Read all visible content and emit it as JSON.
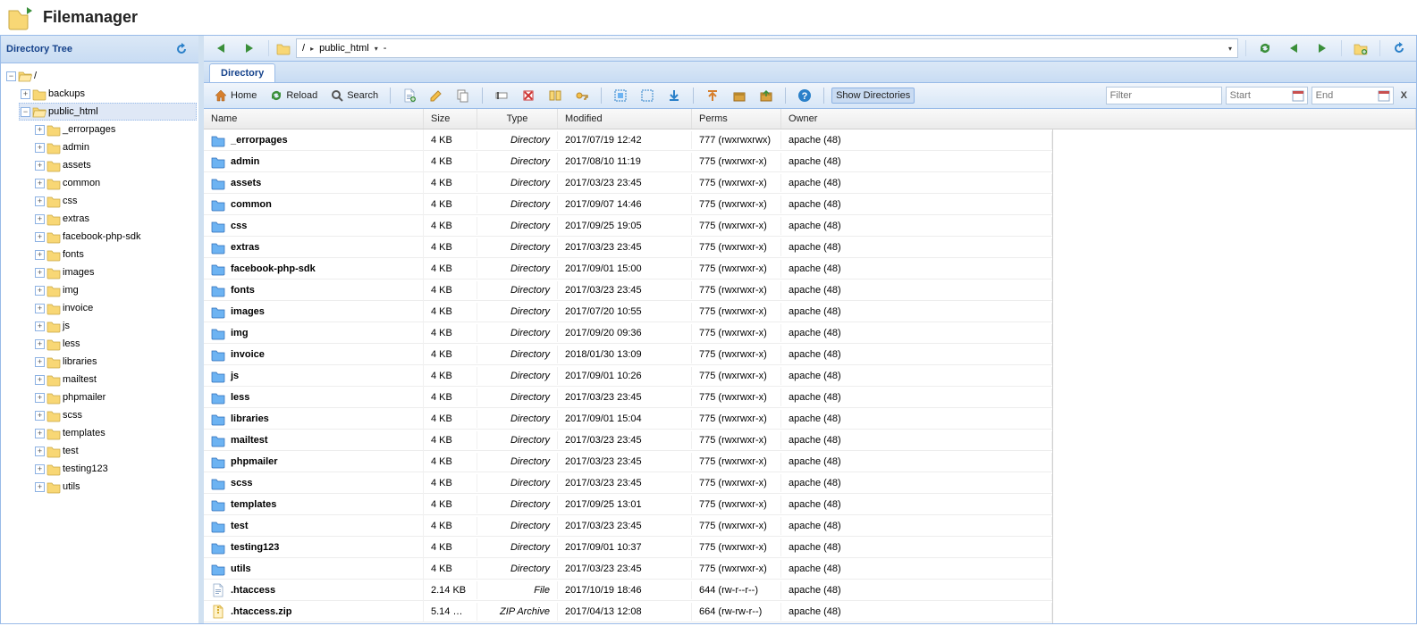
{
  "header": {
    "title": "Filemanager"
  },
  "sidebar": {
    "title": "Directory Tree",
    "root": "/",
    "nodes": [
      {
        "label": "backups"
      },
      {
        "label": "public_html",
        "expanded": true,
        "selected": true,
        "children": [
          "_errorpages",
          "admin",
          "assets",
          "common",
          "css",
          "extras",
          "facebook-php-sdk",
          "fonts",
          "images",
          "img",
          "invoice",
          "js",
          "less",
          "libraries",
          "mailtest",
          "phpmailer",
          "scss",
          "templates",
          "test",
          "testing123",
          "utils"
        ]
      }
    ]
  },
  "breadcrumb": {
    "root": "/",
    "segment": "public_html",
    "trailing": "-"
  },
  "tab": {
    "label": "Directory"
  },
  "toolbar": {
    "home": "Home",
    "reload": "Reload",
    "search": "Search",
    "showDirs": "Show Directories",
    "filterPH": "Filter",
    "startPH": "Start",
    "endPH": "End",
    "clearX": "X"
  },
  "columns": {
    "name": "Name",
    "size": "Size",
    "type": "Type",
    "modified": "Modified",
    "perms": "Perms",
    "owner": "Owner"
  },
  "rows": [
    {
      "icon": "folder",
      "name": "_errorpages",
      "size": "4 KB",
      "type": "Directory",
      "modified": "2017/07/19 12:42",
      "perms": "777 (rwxrwxrwx)",
      "owner": "apache (48)"
    },
    {
      "icon": "folder",
      "name": "admin",
      "size": "4 KB",
      "type": "Directory",
      "modified": "2017/08/10 11:19",
      "perms": "775 (rwxrwxr-x)",
      "owner": "apache (48)"
    },
    {
      "icon": "folder",
      "name": "assets",
      "size": "4 KB",
      "type": "Directory",
      "modified": "2017/03/23 23:45",
      "perms": "775 (rwxrwxr-x)",
      "owner": "apache (48)"
    },
    {
      "icon": "folder",
      "name": "common",
      "size": "4 KB",
      "type": "Directory",
      "modified": "2017/09/07 14:46",
      "perms": "775 (rwxrwxr-x)",
      "owner": "apache (48)"
    },
    {
      "icon": "folder",
      "name": "css",
      "size": "4 KB",
      "type": "Directory",
      "modified": "2017/09/25 19:05",
      "perms": "775 (rwxrwxr-x)",
      "owner": "apache (48)"
    },
    {
      "icon": "folder",
      "name": "extras",
      "size": "4 KB",
      "type": "Directory",
      "modified": "2017/03/23 23:45",
      "perms": "775 (rwxrwxr-x)",
      "owner": "apache (48)"
    },
    {
      "icon": "folder",
      "name": "facebook-php-sdk",
      "size": "4 KB",
      "type": "Directory",
      "modified": "2017/09/01 15:00",
      "perms": "775 (rwxrwxr-x)",
      "owner": "apache (48)"
    },
    {
      "icon": "folder",
      "name": "fonts",
      "size": "4 KB",
      "type": "Directory",
      "modified": "2017/03/23 23:45",
      "perms": "775 (rwxrwxr-x)",
      "owner": "apache (48)"
    },
    {
      "icon": "folder",
      "name": "images",
      "size": "4 KB",
      "type": "Directory",
      "modified": "2017/07/20 10:55",
      "perms": "775 (rwxrwxr-x)",
      "owner": "apache (48)"
    },
    {
      "icon": "folder",
      "name": "img",
      "size": "4 KB",
      "type": "Directory",
      "modified": "2017/09/20 09:36",
      "perms": "775 (rwxrwxr-x)",
      "owner": "apache (48)"
    },
    {
      "icon": "folder",
      "name": "invoice",
      "size": "4 KB",
      "type": "Directory",
      "modified": "2018/01/30 13:09",
      "perms": "775 (rwxrwxr-x)",
      "owner": "apache (48)"
    },
    {
      "icon": "folder",
      "name": "js",
      "size": "4 KB",
      "type": "Directory",
      "modified": "2017/09/01 10:26",
      "perms": "775 (rwxrwxr-x)",
      "owner": "apache (48)"
    },
    {
      "icon": "folder",
      "name": "less",
      "size": "4 KB",
      "type": "Directory",
      "modified": "2017/03/23 23:45",
      "perms": "775 (rwxrwxr-x)",
      "owner": "apache (48)"
    },
    {
      "icon": "folder",
      "name": "libraries",
      "size": "4 KB",
      "type": "Directory",
      "modified": "2017/09/01 15:04",
      "perms": "775 (rwxrwxr-x)",
      "owner": "apache (48)"
    },
    {
      "icon": "folder",
      "name": "mailtest",
      "size": "4 KB",
      "type": "Directory",
      "modified": "2017/03/23 23:45",
      "perms": "775 (rwxrwxr-x)",
      "owner": "apache (48)"
    },
    {
      "icon": "folder",
      "name": "phpmailer",
      "size": "4 KB",
      "type": "Directory",
      "modified": "2017/03/23 23:45",
      "perms": "775 (rwxrwxr-x)",
      "owner": "apache (48)"
    },
    {
      "icon": "folder",
      "name": "scss",
      "size": "4 KB",
      "type": "Directory",
      "modified": "2017/03/23 23:45",
      "perms": "775 (rwxrwxr-x)",
      "owner": "apache (48)"
    },
    {
      "icon": "folder",
      "name": "templates",
      "size": "4 KB",
      "type": "Directory",
      "modified": "2017/09/25 13:01",
      "perms": "775 (rwxrwxr-x)",
      "owner": "apache (48)"
    },
    {
      "icon": "folder",
      "name": "test",
      "size": "4 KB",
      "type": "Directory",
      "modified": "2017/03/23 23:45",
      "perms": "775 (rwxrwxr-x)",
      "owner": "apache (48)"
    },
    {
      "icon": "folder",
      "name": "testing123",
      "size": "4 KB",
      "type": "Directory",
      "modified": "2017/09/01 10:37",
      "perms": "775 (rwxrwxr-x)",
      "owner": "apache (48)"
    },
    {
      "icon": "folder",
      "name": "utils",
      "size": "4 KB",
      "type": "Directory",
      "modified": "2017/03/23 23:45",
      "perms": "775 (rwxrwxr-x)",
      "owner": "apache (48)"
    },
    {
      "icon": "file",
      "name": ".htaccess",
      "size": "2.14 KB",
      "type": "File",
      "modified": "2017/10/19 18:46",
      "perms": "644 (rw-r--r--)",
      "owner": "apache (48)"
    },
    {
      "icon": "zip",
      "name": ".htaccess.zip",
      "size": "5.14 …",
      "type": "ZIP Archive",
      "modified": "2017/04/13 12:08",
      "perms": "664 (rw-rw-r--)",
      "owner": "apache (48)"
    }
  ]
}
